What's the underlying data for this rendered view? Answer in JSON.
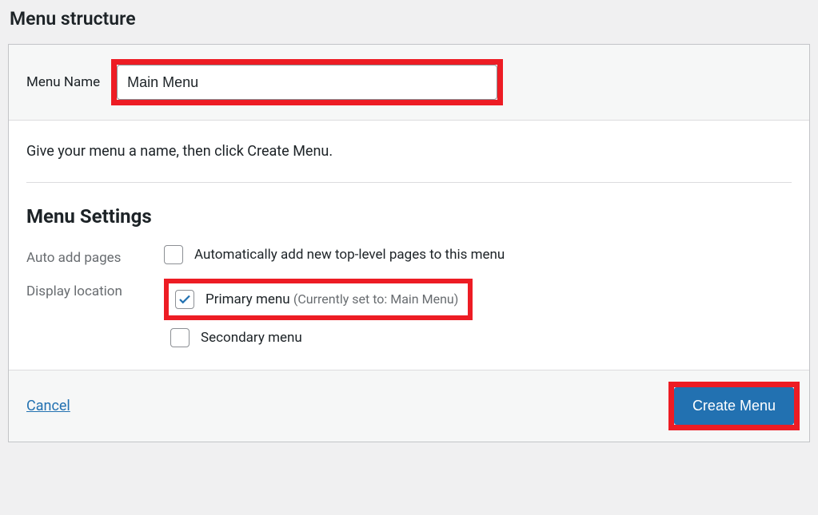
{
  "page": {
    "title": "Menu structure"
  },
  "menuName": {
    "label": "Menu Name",
    "value": "Main Menu"
  },
  "instruction": "Give your menu a name, then click Create Menu.",
  "settings": {
    "title": "Menu Settings",
    "autoAdd": {
      "label": "Auto add pages",
      "option": "Automatically add new top-level pages to this menu",
      "checked": false
    },
    "displayLocation": {
      "label": "Display location",
      "primary": {
        "label": "Primary menu",
        "hint": "(Currently set to: Main Menu)",
        "checked": true
      },
      "secondary": {
        "label": "Secondary menu",
        "checked": false
      }
    }
  },
  "footer": {
    "cancel": "Cancel",
    "create": "Create Menu"
  }
}
